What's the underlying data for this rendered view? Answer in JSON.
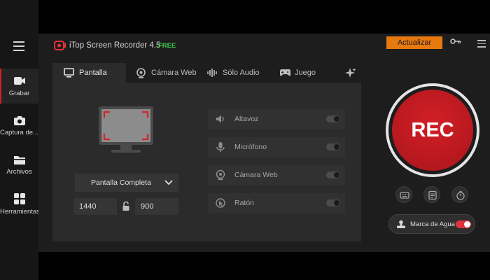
{
  "app": {
    "title": "iTop Screen Recorder 4.5",
    "badge": "FREE",
    "upgrade_label": "Actualizar"
  },
  "sidebar": {
    "items": [
      {
        "label": "Grabar",
        "icon": "camera-record-icon",
        "active": true
      },
      {
        "label": "Captura de...",
        "icon": "screenshot-icon"
      },
      {
        "label": "Archivos",
        "icon": "folder-icon"
      },
      {
        "label": "Herramientas",
        "icon": "tools-grid-icon"
      }
    ]
  },
  "tabs": [
    {
      "label": "Pantalla",
      "icon": "monitor-icon",
      "active": true
    },
    {
      "label": "Cámara Web",
      "icon": "webcam-icon"
    },
    {
      "label": "Sólo Audio",
      "icon": "audio-wave-icon"
    },
    {
      "label": "Juego",
      "icon": "gamepad-icon"
    }
  ],
  "capture": {
    "mode": "Pantalla Completa",
    "width": "1440",
    "height": "900"
  },
  "options": [
    {
      "label": "Altavoz",
      "icon": "speaker-icon",
      "enabled": false
    },
    {
      "label": "Micrófono",
      "icon": "microphone-icon",
      "enabled": false
    },
    {
      "label": "Cámara Web",
      "icon": "webcam-icon",
      "enabled": false
    },
    {
      "label": "Ratón",
      "icon": "mouse-pointer-icon",
      "enabled": false
    }
  ],
  "record": {
    "label": "REC"
  },
  "watermark": {
    "label": "Marca de Agua",
    "enabled": true
  },
  "colors": {
    "accent_red": "#d21e28",
    "upgrade_orange": "#e8790f",
    "free_green": "#3fc84a"
  }
}
